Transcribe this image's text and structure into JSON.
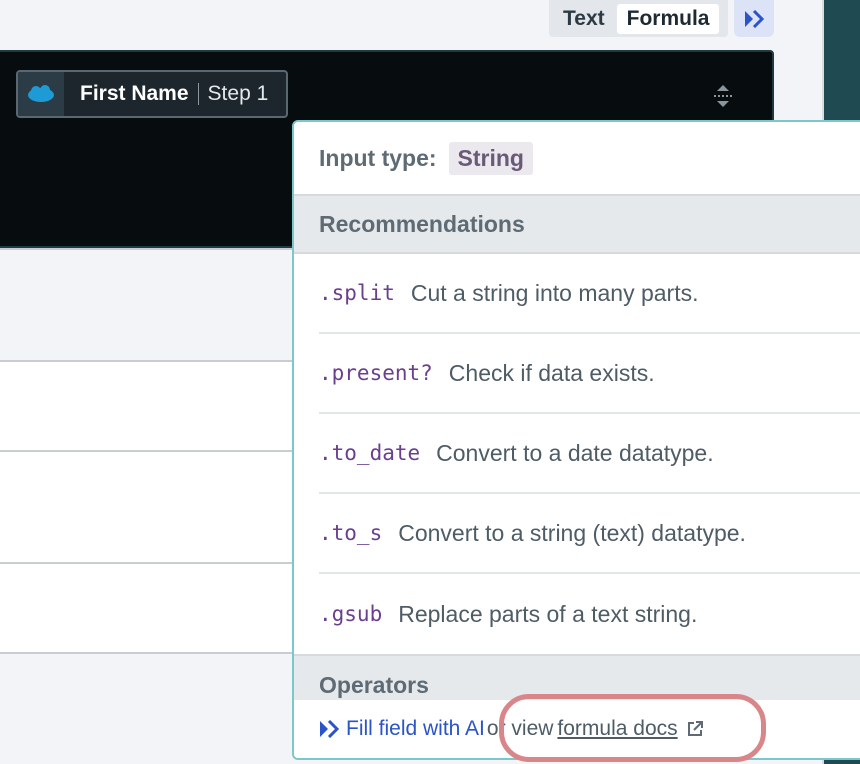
{
  "toggle": {
    "text_label": "Text",
    "formula_label": "Formula"
  },
  "pill": {
    "field_name": "First Name",
    "step_label": "Step 1",
    "logo_icon": "salesforce-icon"
  },
  "popover": {
    "input_type_label": "Input type:",
    "input_type_value": "String",
    "recommendations_title": "Recommendations",
    "recommendations": [
      {
        "code": ".split",
        "desc": "Cut a string into many parts."
      },
      {
        "code": ".present?",
        "desc": "Check if data exists."
      },
      {
        "code": ".to_date",
        "desc": "Convert to a date datatype."
      },
      {
        "code": ".to_s",
        "desc": "Convert to a string (text) datatype."
      },
      {
        "code": ".gsub",
        "desc": "Replace parts of a text string."
      }
    ],
    "operators_title": "Operators",
    "footer": {
      "ai_link": "Fill field with AI",
      "or_text": "or view",
      "docs_link": "formula docs"
    }
  },
  "colors": {
    "accent": "#2a54c8",
    "code": "#6a3f8f",
    "highlight": "#d9868a",
    "popover_border": "#7cc7c7"
  }
}
